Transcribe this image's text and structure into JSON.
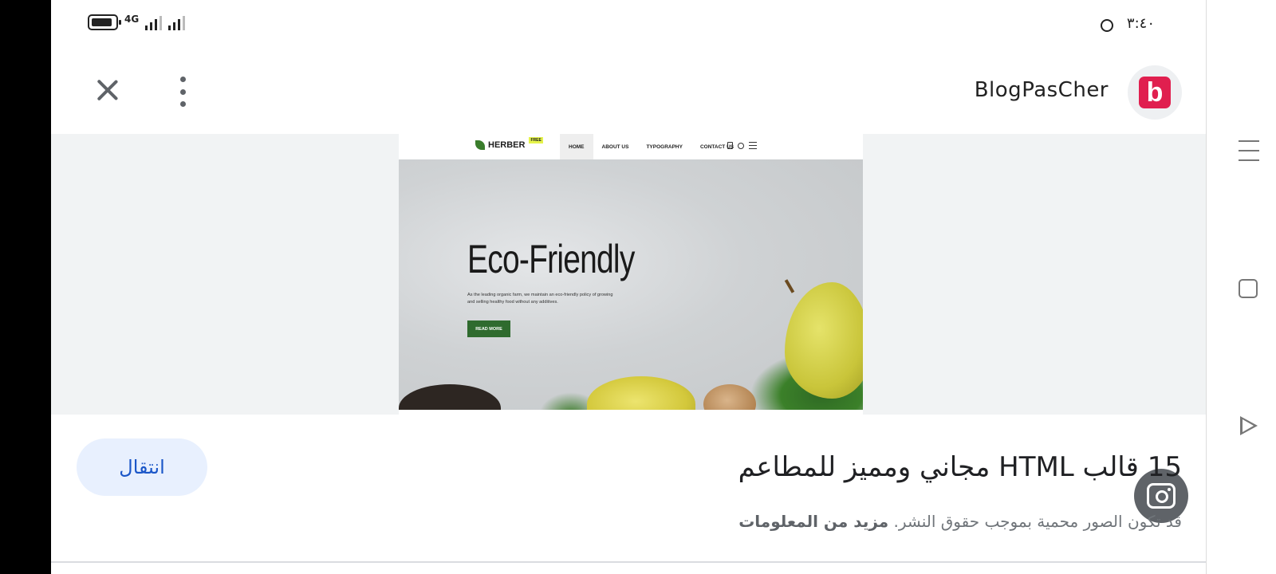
{
  "status_bar": {
    "network": "4G",
    "time": "٣:٤٠"
  },
  "toolbar": {
    "site_name": "BlogPasCher",
    "site_logo_letter": "b",
    "brand_color": "#e01f4f"
  },
  "preview": {
    "brand": "HERBER",
    "brand_badge": "FREE",
    "nav": [
      "HOME",
      "ABOUT US",
      "TYPOGRAPHY",
      "CONTACT US"
    ],
    "hero_title": "Eco-Friendly",
    "hero_text": "As the leading organic farm, we maintain an eco-friendly policy of growing and selling healthy food without any additives.",
    "hero_button": "READ MORE"
  },
  "result": {
    "visit_label": "انتقال",
    "title": "15 قالب HTML مجاني ومميز للمطاعم",
    "note": "قد تكون الصور محمية بموجب حقوق النشر.",
    "note_link": "مزيد من المعلومات"
  },
  "icons": {
    "close": "close-icon",
    "more": "more-vert-icon",
    "lens": "google-lens-icon",
    "recents": "recents-icon",
    "home": "home-icon",
    "back": "back-icon"
  }
}
